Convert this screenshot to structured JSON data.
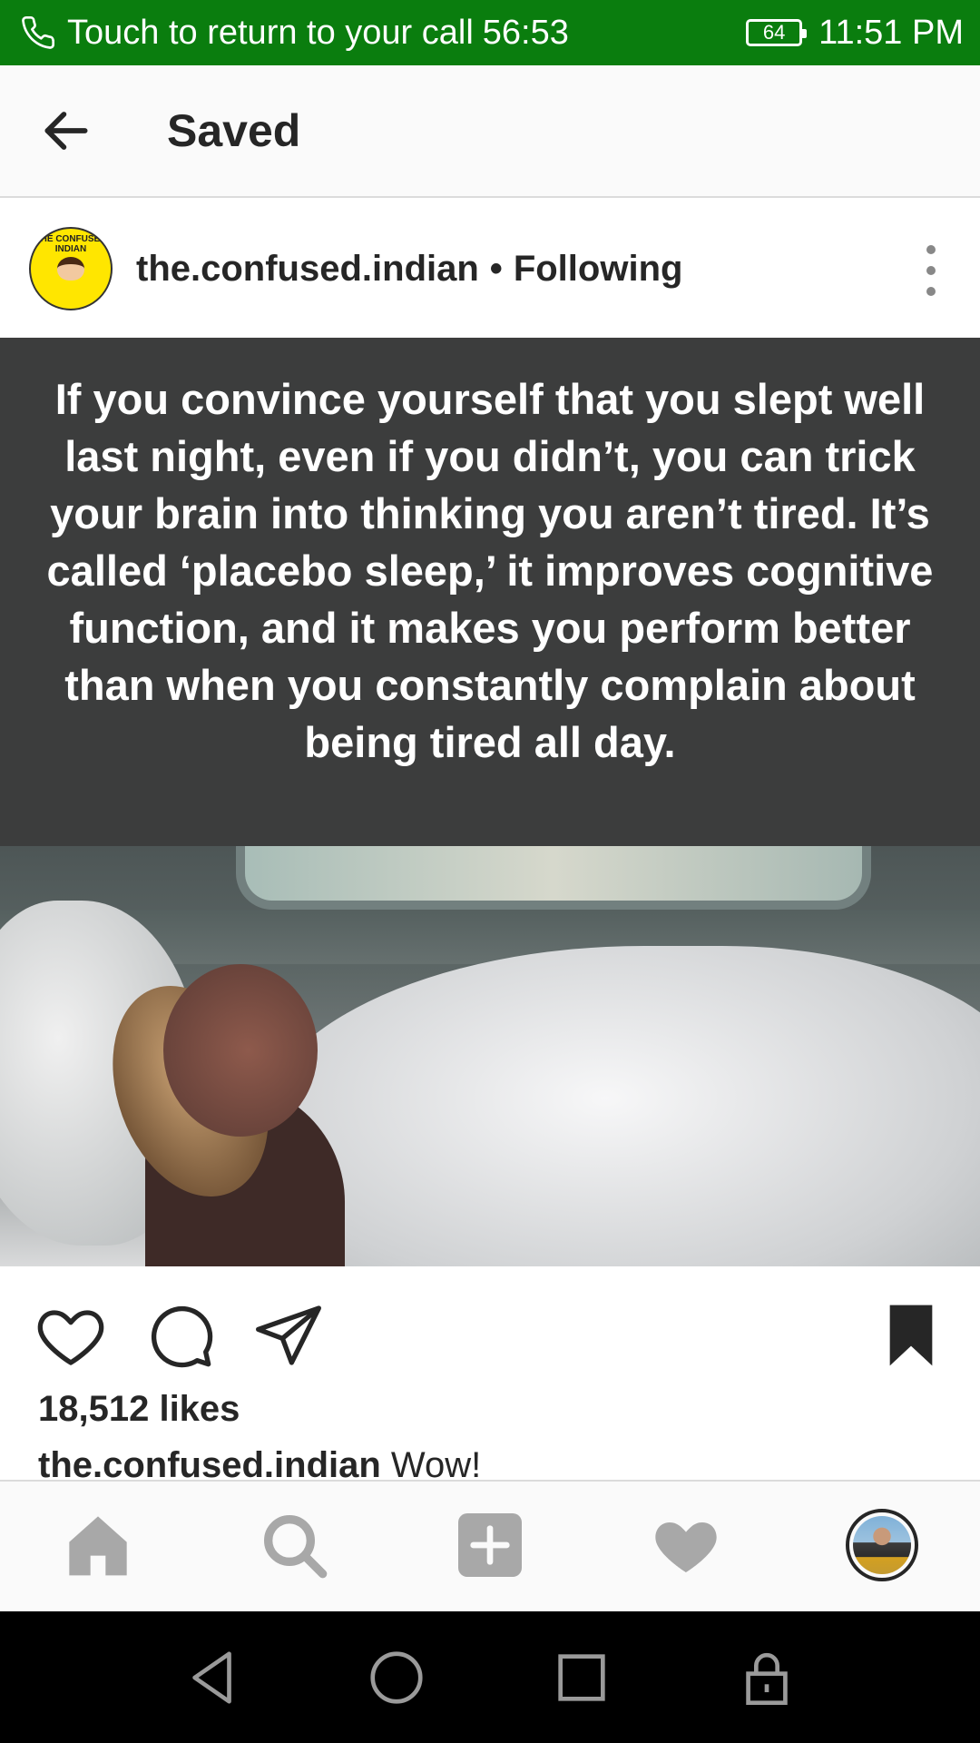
{
  "status_bar": {
    "call_text": "Touch to return to your call",
    "call_timer": "56:53",
    "battery": "64",
    "time": "11:51 PM"
  },
  "header": {
    "title": "Saved"
  },
  "post": {
    "avatar_text": "THE CONFUSED INDIAN",
    "username": "the.confused.indian",
    "separator": "•",
    "follow_status": "Following",
    "quote": "If you convince yourself that you slept well last night, even if you didn’t, you can trick your brain into thinking you aren’t tired. It’s called ‘placebo sleep,’ it improves cognitive function, and it makes you perform better than when you constantly complain about being tired all day.",
    "likes": "18,512 likes",
    "caption_user": "the.confused.indian",
    "caption_text": "Wow!"
  },
  "icons": {
    "back": "back-arrow-icon",
    "more": "more-vertical-icon",
    "like": "heart-outline-icon",
    "comment": "comment-icon",
    "share": "paper-plane-icon",
    "bookmark": "bookmark-filled-icon",
    "home": "home-icon",
    "search": "search-icon",
    "add": "add-post-icon",
    "activity": "heart-filled-icon",
    "profile": "profile-avatar"
  },
  "colors": {
    "status_bar": "#0a7d0e",
    "quote_bg": "#3c3d3d",
    "nav_icon_inactive": "#a8a8a8"
  }
}
